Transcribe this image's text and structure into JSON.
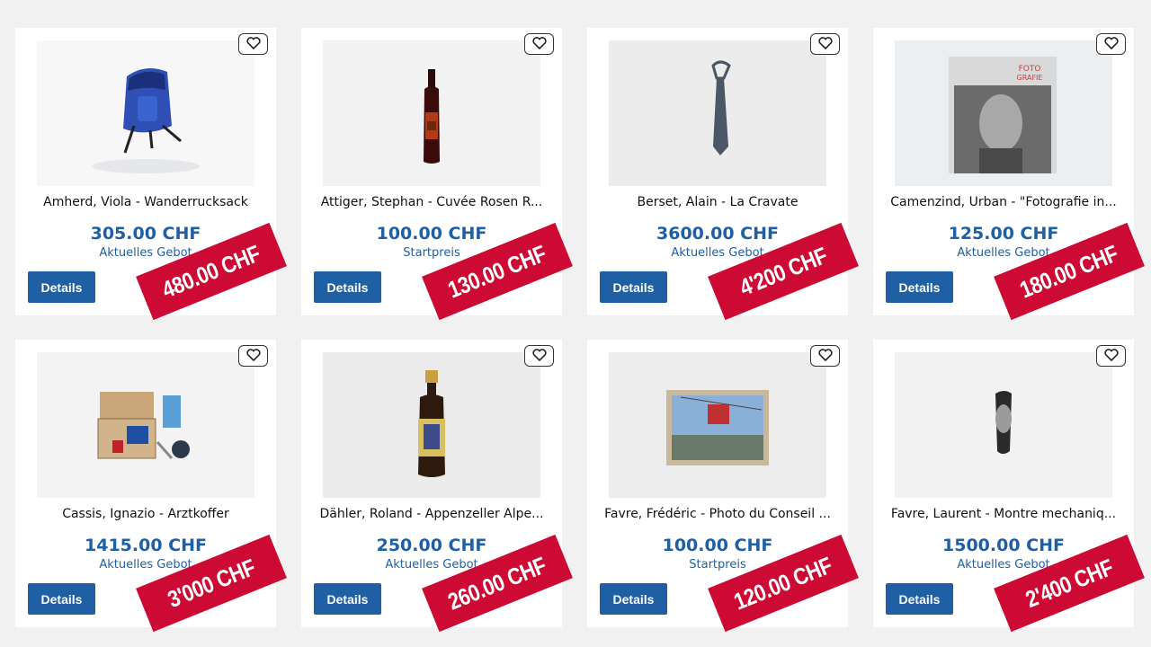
{
  "colors": {
    "price": "#1f5fa3",
    "button": "#1f5fa3",
    "stamp": "#cc0a34",
    "background": "#f1f1f1"
  },
  "items": [
    {
      "title": "Amherd, Viola - Wanderrucksack",
      "price": "305.00 CHF",
      "price_label": "Aktuelles Gebot",
      "button": "Details",
      "final": "480.00 CHF",
      "image": "backpack"
    },
    {
      "title": "Attiger, Stephan - Cuvée Rosen R...",
      "price": "100.00 CHF",
      "price_label": "Startpreis",
      "button": "Details",
      "final": "130.00 CHF",
      "image": "wine-bottle"
    },
    {
      "title": "Berset, Alain - La Cravate",
      "price": "3600.00 CHF",
      "price_label": "Aktuelles Gebot",
      "button": "Details",
      "final": "4'200 CHF",
      "image": "tie"
    },
    {
      "title": "Camenzind, Urban - \"Fotografie in...",
      "price": "125.00 CHF",
      "price_label": "Aktuelles Gebot",
      "button": "Details",
      "final": "180.00 CHF",
      "image": "photo-book"
    },
    {
      "title": "Cassis, Ignazio - Arztkoffer",
      "price": "1415.00 CHF",
      "price_label": "Aktuelles Gebot",
      "button": "Details",
      "final": "3'000 CHF",
      "image": "doctor-kit"
    },
    {
      "title": "Dähler, Roland - Appenzeller Alpe...",
      "price": "250.00 CHF",
      "price_label": "Aktuelles Gebot",
      "button": "Details",
      "final": "260.00 CHF",
      "image": "liqueur-bottle"
    },
    {
      "title": "Favre, Frédéric - Photo du Conseil ...",
      "price": "100.00 CHF",
      "price_label": "Startpreis",
      "button": "Details",
      "final": "120.00 CHF",
      "image": "framed-photo"
    },
    {
      "title": "Favre, Laurent - Montre mechaniq...",
      "price": "1500.00 CHF",
      "price_label": "Aktuelles Gebot",
      "button": "Details",
      "final": "2'400 CHF",
      "image": "watch"
    }
  ],
  "icons": {
    "favorite": "heart-icon"
  }
}
